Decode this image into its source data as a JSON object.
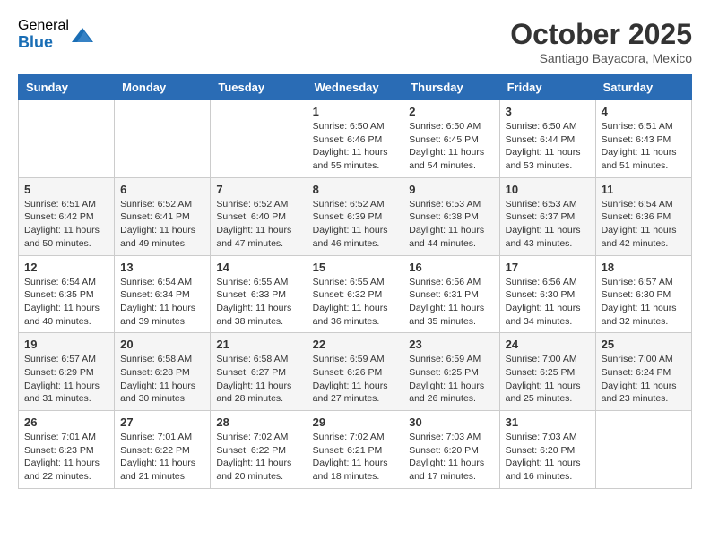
{
  "logo": {
    "general": "General",
    "blue": "Blue"
  },
  "header": {
    "month": "October 2025",
    "location": "Santiago Bayacora, Mexico"
  },
  "weekdays": [
    "Sunday",
    "Monday",
    "Tuesday",
    "Wednesday",
    "Thursday",
    "Friday",
    "Saturday"
  ],
  "weeks": [
    [
      {
        "day": "",
        "info": ""
      },
      {
        "day": "",
        "info": ""
      },
      {
        "day": "",
        "info": ""
      },
      {
        "day": "1",
        "info": "Sunrise: 6:50 AM\nSunset: 6:46 PM\nDaylight: 11 hours\nand 55 minutes."
      },
      {
        "day": "2",
        "info": "Sunrise: 6:50 AM\nSunset: 6:45 PM\nDaylight: 11 hours\nand 54 minutes."
      },
      {
        "day": "3",
        "info": "Sunrise: 6:50 AM\nSunset: 6:44 PM\nDaylight: 11 hours\nand 53 minutes."
      },
      {
        "day": "4",
        "info": "Sunrise: 6:51 AM\nSunset: 6:43 PM\nDaylight: 11 hours\nand 51 minutes."
      }
    ],
    [
      {
        "day": "5",
        "info": "Sunrise: 6:51 AM\nSunset: 6:42 PM\nDaylight: 11 hours\nand 50 minutes."
      },
      {
        "day": "6",
        "info": "Sunrise: 6:52 AM\nSunset: 6:41 PM\nDaylight: 11 hours\nand 49 minutes."
      },
      {
        "day": "7",
        "info": "Sunrise: 6:52 AM\nSunset: 6:40 PM\nDaylight: 11 hours\nand 47 minutes."
      },
      {
        "day": "8",
        "info": "Sunrise: 6:52 AM\nSunset: 6:39 PM\nDaylight: 11 hours\nand 46 minutes."
      },
      {
        "day": "9",
        "info": "Sunrise: 6:53 AM\nSunset: 6:38 PM\nDaylight: 11 hours\nand 44 minutes."
      },
      {
        "day": "10",
        "info": "Sunrise: 6:53 AM\nSunset: 6:37 PM\nDaylight: 11 hours\nand 43 minutes."
      },
      {
        "day": "11",
        "info": "Sunrise: 6:54 AM\nSunset: 6:36 PM\nDaylight: 11 hours\nand 42 minutes."
      }
    ],
    [
      {
        "day": "12",
        "info": "Sunrise: 6:54 AM\nSunset: 6:35 PM\nDaylight: 11 hours\nand 40 minutes."
      },
      {
        "day": "13",
        "info": "Sunrise: 6:54 AM\nSunset: 6:34 PM\nDaylight: 11 hours\nand 39 minutes."
      },
      {
        "day": "14",
        "info": "Sunrise: 6:55 AM\nSunset: 6:33 PM\nDaylight: 11 hours\nand 38 minutes."
      },
      {
        "day": "15",
        "info": "Sunrise: 6:55 AM\nSunset: 6:32 PM\nDaylight: 11 hours\nand 36 minutes."
      },
      {
        "day": "16",
        "info": "Sunrise: 6:56 AM\nSunset: 6:31 PM\nDaylight: 11 hours\nand 35 minutes."
      },
      {
        "day": "17",
        "info": "Sunrise: 6:56 AM\nSunset: 6:30 PM\nDaylight: 11 hours\nand 34 minutes."
      },
      {
        "day": "18",
        "info": "Sunrise: 6:57 AM\nSunset: 6:30 PM\nDaylight: 11 hours\nand 32 minutes."
      }
    ],
    [
      {
        "day": "19",
        "info": "Sunrise: 6:57 AM\nSunset: 6:29 PM\nDaylight: 11 hours\nand 31 minutes."
      },
      {
        "day": "20",
        "info": "Sunrise: 6:58 AM\nSunset: 6:28 PM\nDaylight: 11 hours\nand 30 minutes."
      },
      {
        "day": "21",
        "info": "Sunrise: 6:58 AM\nSunset: 6:27 PM\nDaylight: 11 hours\nand 28 minutes."
      },
      {
        "day": "22",
        "info": "Sunrise: 6:59 AM\nSunset: 6:26 PM\nDaylight: 11 hours\nand 27 minutes."
      },
      {
        "day": "23",
        "info": "Sunrise: 6:59 AM\nSunset: 6:25 PM\nDaylight: 11 hours\nand 26 minutes."
      },
      {
        "day": "24",
        "info": "Sunrise: 7:00 AM\nSunset: 6:25 PM\nDaylight: 11 hours\nand 25 minutes."
      },
      {
        "day": "25",
        "info": "Sunrise: 7:00 AM\nSunset: 6:24 PM\nDaylight: 11 hours\nand 23 minutes."
      }
    ],
    [
      {
        "day": "26",
        "info": "Sunrise: 7:01 AM\nSunset: 6:23 PM\nDaylight: 11 hours\nand 22 minutes."
      },
      {
        "day": "27",
        "info": "Sunrise: 7:01 AM\nSunset: 6:22 PM\nDaylight: 11 hours\nand 21 minutes."
      },
      {
        "day": "28",
        "info": "Sunrise: 7:02 AM\nSunset: 6:22 PM\nDaylight: 11 hours\nand 20 minutes."
      },
      {
        "day": "29",
        "info": "Sunrise: 7:02 AM\nSunset: 6:21 PM\nDaylight: 11 hours\nand 18 minutes."
      },
      {
        "day": "30",
        "info": "Sunrise: 7:03 AM\nSunset: 6:20 PM\nDaylight: 11 hours\nand 17 minutes."
      },
      {
        "day": "31",
        "info": "Sunrise: 7:03 AM\nSunset: 6:20 PM\nDaylight: 11 hours\nand 16 minutes."
      },
      {
        "day": "",
        "info": ""
      }
    ]
  ]
}
